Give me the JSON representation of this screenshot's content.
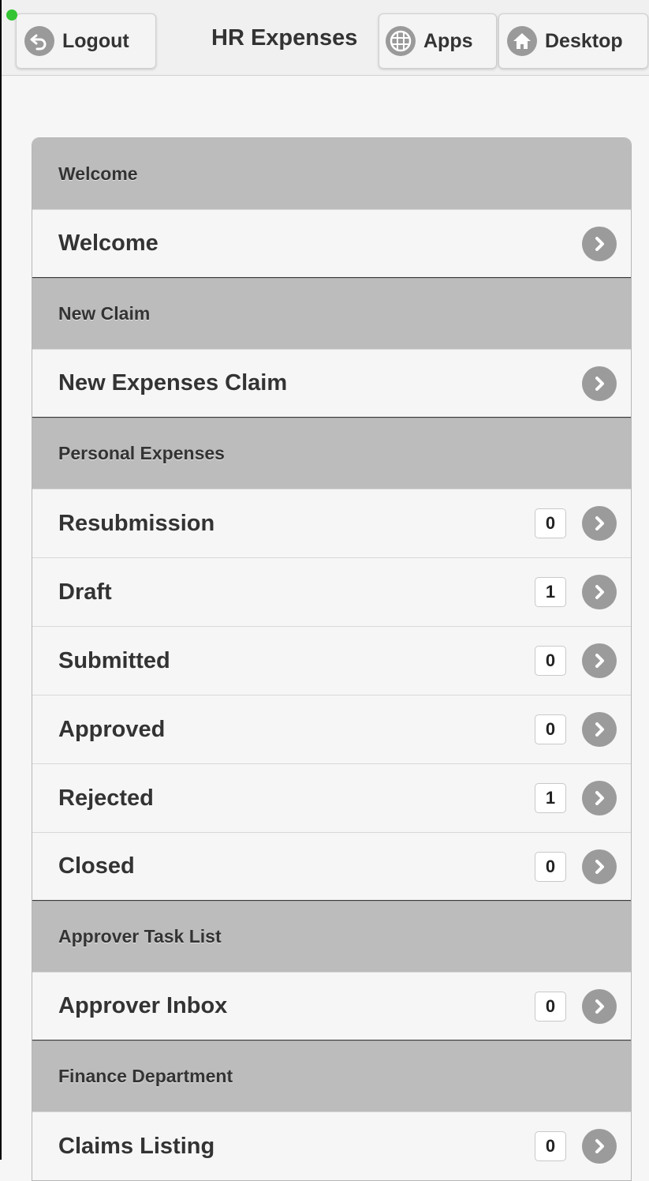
{
  "header": {
    "title": "HR Expenses",
    "logout_label": "Logout",
    "apps_label": "Apps",
    "desktop_label": "Desktop",
    "status_color": "#34c434"
  },
  "groups": [
    {
      "divider": "Welcome",
      "items": [
        {
          "label": "Welcome",
          "count": null,
          "icon": "chevron-right-icon"
        }
      ]
    },
    {
      "divider": "New Claim",
      "items": [
        {
          "label": "New Expenses Claim",
          "count": null,
          "icon": "chevron-right-icon"
        }
      ]
    },
    {
      "divider": "Personal Expenses",
      "items": [
        {
          "label": "Resubmission",
          "count": "0",
          "icon": "chevron-right-icon"
        },
        {
          "label": "Draft",
          "count": "1",
          "icon": "chevron-right-icon"
        },
        {
          "label": "Submitted",
          "count": "0",
          "icon": "chevron-right-icon"
        },
        {
          "label": "Approved",
          "count": "0",
          "icon": "chevron-right-icon"
        },
        {
          "label": "Rejected",
          "count": "1",
          "icon": "chevron-right-icon"
        },
        {
          "label": "Closed",
          "count": "0",
          "icon": "chevron-right-icon"
        }
      ]
    },
    {
      "divider": "Approver Task List",
      "items": [
        {
          "label": "Approver Inbox",
          "count": "0",
          "icon": "chevron-right-icon"
        }
      ]
    },
    {
      "divider": "Finance Department",
      "items": [
        {
          "label": "Claims Listing",
          "count": "0",
          "icon": "chevron-right-icon"
        }
      ]
    }
  ]
}
